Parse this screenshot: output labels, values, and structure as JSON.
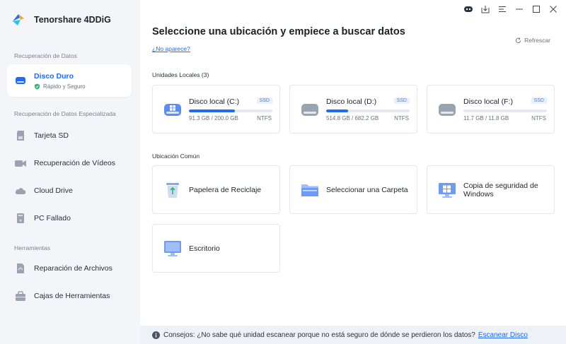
{
  "app": {
    "name": "Tenorshare 4DDiG"
  },
  "sidebar": {
    "section1": "Recuperación de Datos",
    "active_item": {
      "label": "Disco Duro",
      "sub": "Rápido y Seguro"
    },
    "section2": "Recuperación de Datos Especializada",
    "items2": [
      {
        "label": "Tarjeta SD",
        "icon": "sd-card-icon"
      },
      {
        "label": "Recuperación de Vídeos",
        "icon": "video-camera-icon"
      },
      {
        "label": "Cloud Drive",
        "icon": "cloud-icon"
      },
      {
        "label": "PC Fallado",
        "icon": "crashed-pc-icon"
      }
    ],
    "section3": "Herramientas",
    "items3": [
      {
        "label": "Reparación de Archivos",
        "icon": "file-repair-icon"
      },
      {
        "label": "Cajas de Herramientas",
        "icon": "toolbox-icon"
      }
    ]
  },
  "main": {
    "title": "Seleccione una ubicación y empiece a buscar datos",
    "link": "¿No aparece?",
    "refresh": "Refrescar",
    "local_label": "Unidades Locales (3)",
    "drives": [
      {
        "name": "Disco local (C:)",
        "badge": "SSD",
        "size": "91.3 GB / 200.0 GB",
        "fs": "NTFS",
        "used": 0.55
      },
      {
        "name": "Disco local (D:)",
        "badge": "SSD",
        "size": "514.8 GB / 682.2 GB",
        "fs": "NTFS",
        "used": 0.26
      },
      {
        "name": "Disco local (F:)",
        "badge": "SSD",
        "size": "11.7 GB / 11.8 GB",
        "fs": "NTFS",
        "used": 0.0
      }
    ],
    "common_label": "Ubicación Común",
    "locations": [
      {
        "label": "Papelera de Reciclaje",
        "icon": "recycle-bin-icon"
      },
      {
        "label": "Seleccionar una Carpeta",
        "icon": "folder-icon"
      },
      {
        "label": "Copia de seguridad de Windows",
        "icon": "windows-backup-icon"
      },
      {
        "label": "Escritorio",
        "icon": "desktop-icon"
      }
    ]
  },
  "footer": {
    "text": "Consejos: ¿No sabe qué unidad escanear porque no está seguro de dónde se perdieron los datos?",
    "link": "Escanear Disco"
  },
  "colors": {
    "accent": "#1f6bf5",
    "sidebar_bg": "#f3f5f9",
    "footer_bg": "#eef1f7"
  }
}
